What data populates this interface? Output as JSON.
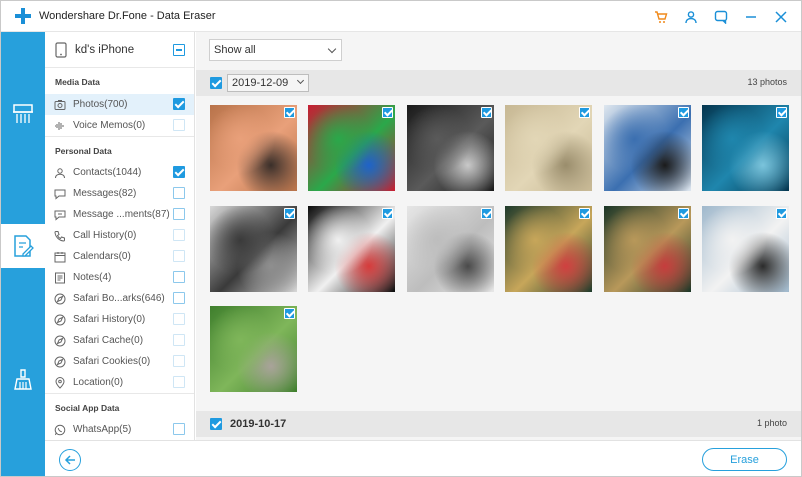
{
  "app": {
    "title": "Wondershare Dr.Fone - Data Eraser"
  },
  "device": {
    "name": "kd's iPhone"
  },
  "sidebar": {
    "sections": [
      {
        "title": "Media Data",
        "items": [
          {
            "label": "Photos(700)",
            "icon": "photo-icon",
            "checked": true,
            "selected": true,
            "dim": false
          },
          {
            "label": "Voice Memos(0)",
            "icon": "waveform-icon",
            "checked": false,
            "selected": false,
            "dim": true
          }
        ]
      },
      {
        "title": "Personal Data",
        "items": [
          {
            "label": "Contacts(1044)",
            "icon": "contacts-icon",
            "checked": true,
            "dim": false
          },
          {
            "label": "Messages(82)",
            "icon": "messages-icon",
            "checked": false,
            "dim": false
          },
          {
            "label": "Message ...ments(87)",
            "icon": "attachment-icon",
            "checked": false,
            "dim": false
          },
          {
            "label": "Call History(0)",
            "icon": "phone-icon",
            "checked": false,
            "dim": true
          },
          {
            "label": "Calendars(0)",
            "icon": "calendar-icon",
            "checked": false,
            "dim": true
          },
          {
            "label": "Notes(4)",
            "icon": "notes-icon",
            "checked": false,
            "dim": false
          },
          {
            "label": "Safari Bo...arks(646)",
            "icon": "safari-icon",
            "checked": false,
            "dim": false
          },
          {
            "label": "Safari History(0)",
            "icon": "safari-icon",
            "checked": false,
            "dim": true
          },
          {
            "label": "Safari Cache(0)",
            "icon": "safari-icon",
            "checked": false,
            "dim": true
          },
          {
            "label": "Safari Cookies(0)",
            "icon": "safari-icon",
            "checked": false,
            "dim": true
          },
          {
            "label": "Location(0)",
            "icon": "location-icon",
            "checked": false,
            "dim": true
          }
        ]
      },
      {
        "title": "Social App Data",
        "items": [
          {
            "label": "WhatsApp(5)",
            "icon": "whatsapp-icon",
            "checked": false,
            "dim": false
          }
        ]
      }
    ]
  },
  "filter": {
    "value": "Show all"
  },
  "groups": [
    {
      "date": "2019-12-09",
      "count": "13 photos",
      "checked": true
    },
    {
      "date": "2019-10-17",
      "count": "1 photo",
      "checked": true
    }
  ],
  "photos": [
    {
      "name": "photo-fox-toy",
      "colors": [
        "#b8734a",
        "#e9a07a",
        "#3a2f2a"
      ],
      "checked": true
    },
    {
      "name": "photo-phone-home-screen",
      "colors": [
        "#c81d33",
        "#2aa84a",
        "#1f63c9"
      ],
      "checked": true
    },
    {
      "name": "photo-cables",
      "colors": [
        "#1a1a1a",
        "#5a5a5a",
        "#c9c9c9"
      ],
      "checked": true
    },
    {
      "name": "photo-beige-surface",
      "colors": [
        "#c7b894",
        "#e2d6b6",
        "#9a8d6c"
      ],
      "checked": true
    },
    {
      "name": "photo-monitor-screen",
      "colors": [
        "#dfe7ef",
        "#3b6fb0",
        "#1b1b1b"
      ],
      "checked": true
    },
    {
      "name": "photo-dolphin-underwater",
      "colors": [
        "#05364f",
        "#1f86ad",
        "#7bc4dc"
      ],
      "checked": true
    },
    {
      "name": "photo-monitor-stand",
      "colors": [
        "#d8d8d8",
        "#3a3a3a",
        "#8f8f8f"
      ],
      "checked": true
    },
    {
      "name": "photo-code-screen",
      "colors": [
        "#0b0b0b",
        "#f0f0f0",
        "#d63b3b"
      ],
      "checked": true
    },
    {
      "name": "photo-phone-on-desk",
      "colors": [
        "#e6e6e6",
        "#bdbdbd",
        "#4a4a4a"
      ],
      "checked": true
    },
    {
      "name": "photo-group-basketball-1",
      "colors": [
        "#1f3a2b",
        "#c7a65a",
        "#d04040"
      ],
      "checked": true
    },
    {
      "name": "photo-group-basketball-2",
      "colors": [
        "#1c3627",
        "#b8985a",
        "#c63d3d"
      ],
      "checked": true
    },
    {
      "name": "photo-person-glasses",
      "colors": [
        "#9fb8cc",
        "#f2f2f2",
        "#2b2b2b"
      ],
      "checked": true
    },
    {
      "name": "photo-green-plant",
      "colors": [
        "#3f7f2d",
        "#7fb65a",
        "#a9a39a"
      ],
      "checked": true
    }
  ],
  "bottom": {
    "erase_label": "Erase"
  },
  "colors": {
    "accent": "#27a0dc",
    "checkbox": "#1f9ae0",
    "selected_row": "#e3f1fb"
  }
}
